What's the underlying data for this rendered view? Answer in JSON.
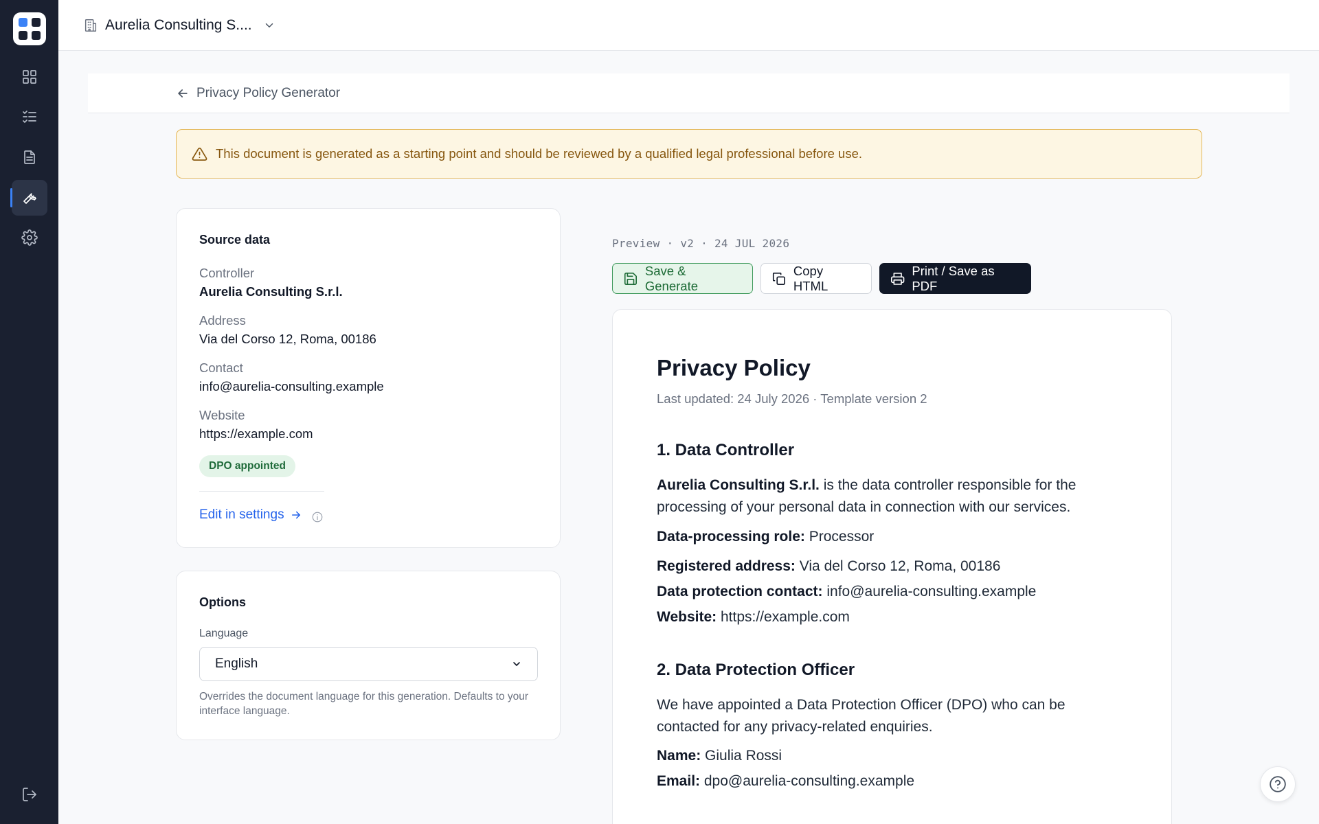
{
  "org": {
    "name": "Aurelia Consulting S...."
  },
  "breadcrumb": {
    "back_label": "Privacy Policy Generator"
  },
  "warning": {
    "text": "This document is generated as a starting point and should be reviewed by a qualified legal professional before use."
  },
  "source": {
    "title": "Source data",
    "controller_label": "Controller",
    "controller_value": "Aurelia Consulting S.r.l.",
    "address_label": "Address",
    "address_value": "Via del Corso 12, Roma, 00186",
    "contact_label": "Contact",
    "contact_value": "info@aurelia-consulting.example",
    "website_label": "Website",
    "website_value": "https://example.com",
    "badge": "DPO appointed",
    "edit_link": "Edit in settings"
  },
  "options": {
    "title": "Options",
    "language_label": "Language",
    "language_value": "English",
    "help": "Overrides the document language for this generation. Defaults to your interface language."
  },
  "preview": {
    "meta": "Preview · v2 · 24 JUL 2026",
    "save_label": "Save & Generate",
    "copy_label": "Copy HTML",
    "print_label": "Print / Save as PDF"
  },
  "doc": {
    "title": "Privacy Policy",
    "subtitle": "Last updated: 24 July 2026 · Template version 2",
    "s1_heading": "1. Data Controller",
    "s1_controller": "Aurelia Consulting S.r.l.",
    "s1_text": "is the data controller responsible for the processing of your personal data in connection with our services.",
    "role_label": "Data-processing role:",
    "role_value": "Processor",
    "address_label": "Registered address:",
    "address_value": "Via del Corso 12, Roma, 00186",
    "contact_label": "Data protection contact:",
    "contact_value": "info@aurelia-consulting.example",
    "website_label": "Website:",
    "website_value": "https://example.com",
    "s2_heading": "2. Data Protection Officer",
    "s2_text": "We have appointed a Data Protection Officer (DPO) who can be contacted for any privacy-related enquiries.",
    "name_label": "Name:",
    "name_value": "Giulia Rossi",
    "email_label": "Email:",
    "email_value": "dpo@aurelia-consulting.example"
  },
  "colors": {
    "sidebar": "#1a2030",
    "accent": "#3b82f6",
    "warning_bg": "#fdf6e3",
    "warning_border": "#e4b85a",
    "success": "#1d6b36",
    "link": "#2563eb"
  },
  "icons": {
    "nav": [
      "dashboard-icon",
      "checklist-icon",
      "document-icon",
      "wrench-icon",
      "gear-icon"
    ],
    "logout": "logout-icon",
    "help": "help-icon"
  }
}
